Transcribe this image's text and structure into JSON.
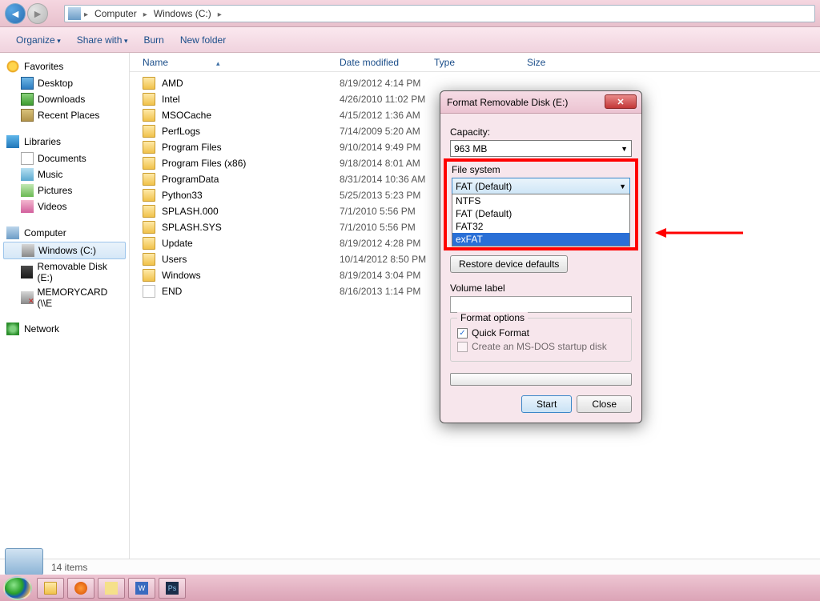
{
  "breadcrumbs": [
    "Computer",
    "Windows (C:)"
  ],
  "toolbar": {
    "organize": "Organize",
    "share": "Share with",
    "burn": "Burn",
    "newfolder": "New folder"
  },
  "columns": {
    "name": "Name",
    "date": "Date modified",
    "type": "Type",
    "size": "Size"
  },
  "nav": {
    "favorites": {
      "label": "Favorites",
      "items": [
        "Desktop",
        "Downloads",
        "Recent Places"
      ]
    },
    "libraries": {
      "label": "Libraries",
      "items": [
        "Documents",
        "Music",
        "Pictures",
        "Videos"
      ]
    },
    "computer": {
      "label": "Computer",
      "items": [
        "Windows (C:)",
        "Removable Disk (E:)",
        "MEMORYCARD (\\\\E"
      ]
    },
    "network": {
      "label": "Network"
    }
  },
  "rows": [
    {
      "name": "AMD",
      "date": "8/19/2012 4:14 PM",
      "kind": "folder"
    },
    {
      "name": "Intel",
      "date": "4/26/2010 11:02 PM",
      "kind": "folder"
    },
    {
      "name": "MSOCache",
      "date": "4/15/2012 1:36 AM",
      "kind": "folder"
    },
    {
      "name": "PerfLogs",
      "date": "7/14/2009 5:20 AM",
      "kind": "folder"
    },
    {
      "name": "Program Files",
      "date": "9/10/2014 9:49 PM",
      "kind": "folder"
    },
    {
      "name": "Program Files (x86)",
      "date": "9/18/2014 8:01 AM",
      "kind": "folder"
    },
    {
      "name": "ProgramData",
      "date": "8/31/2014 10:36 AM",
      "kind": "folder"
    },
    {
      "name": "Python33",
      "date": "5/25/2013 5:23 PM",
      "kind": "folder"
    },
    {
      "name": "SPLASH.000",
      "date": "7/1/2010 5:56 PM",
      "kind": "folder"
    },
    {
      "name": "SPLASH.SYS",
      "date": "7/1/2010 5:56 PM",
      "kind": "folder"
    },
    {
      "name": "Update",
      "date": "8/19/2012 4:28 PM",
      "kind": "folder"
    },
    {
      "name": "Users",
      "date": "10/14/2012 8:50 PM",
      "kind": "folder"
    },
    {
      "name": "Windows",
      "date": "8/19/2014 3:04 PM",
      "kind": "folder"
    },
    {
      "name": "END",
      "date": "8/16/2013 1:14 PM",
      "kind": "file"
    }
  ],
  "status": {
    "count": "14 items"
  },
  "dialog": {
    "title": "Format Removable Disk (E:)",
    "capacity_label": "Capacity:",
    "capacity_value": "963 MB",
    "fs_label": "File system",
    "fs_selected": "FAT (Default)",
    "fs_options": [
      "NTFS",
      "FAT (Default)",
      "FAT32",
      "exFAT"
    ],
    "fs_highlight": "exFAT",
    "restore": "Restore device defaults",
    "vol_label": "Volume label",
    "vol_value": "",
    "fmt_options": "Format options",
    "quick": "Quick Format",
    "msdos": "Create an MS-DOS startup disk",
    "start": "Start",
    "close": "Close"
  }
}
